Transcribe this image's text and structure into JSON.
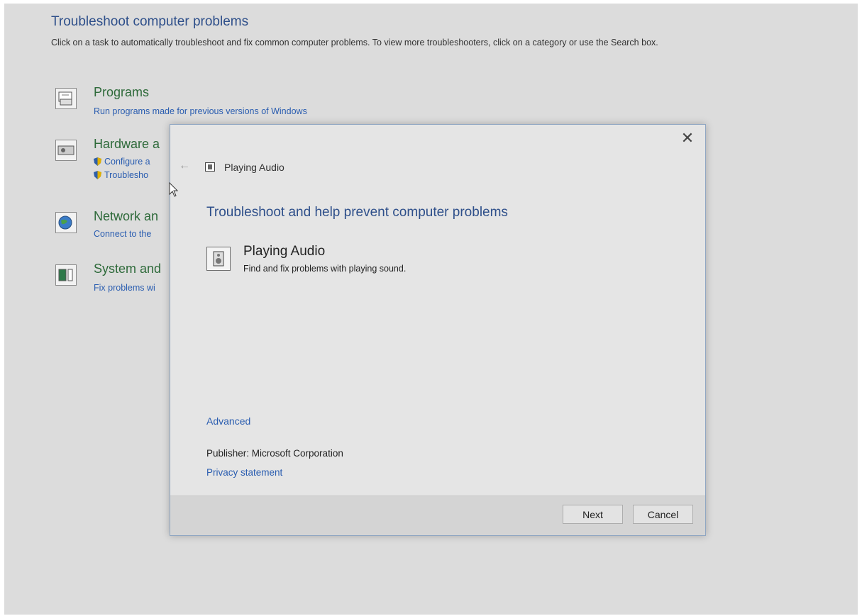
{
  "background": {
    "title": "Troubleshoot computer problems",
    "description": "Click on a task to automatically troubleshoot and fix common computer problems. To view more troubleshooters, click on a category or use the Search box.",
    "categories": [
      {
        "title": "Programs",
        "links": [
          "Run programs made for previous versions of Windows"
        ]
      },
      {
        "title": "Hardware a",
        "links": [
          "Configure a",
          "Troublesho"
        ]
      },
      {
        "title": "Network an",
        "links": [
          "Connect to the"
        ]
      },
      {
        "title": "System and",
        "links": [
          "Fix problems wi"
        ]
      }
    ]
  },
  "dialog": {
    "nav_title": "Playing Audio",
    "heading": "Troubleshoot and help prevent computer problems",
    "item": {
      "title": "Playing Audio",
      "description": "Find and fix problems with playing sound."
    },
    "advanced_link": "Advanced",
    "publisher": "Publisher:  Microsoft Corporation",
    "privacy_link": "Privacy statement",
    "next_label": "Next",
    "cancel_label": "Cancel",
    "close_glyph": "✕",
    "back_glyph": "←"
  },
  "colors": {
    "heading_blue": "#2e4f8a",
    "link_blue": "#2a5db0",
    "category_green": "#2e6a3a"
  }
}
